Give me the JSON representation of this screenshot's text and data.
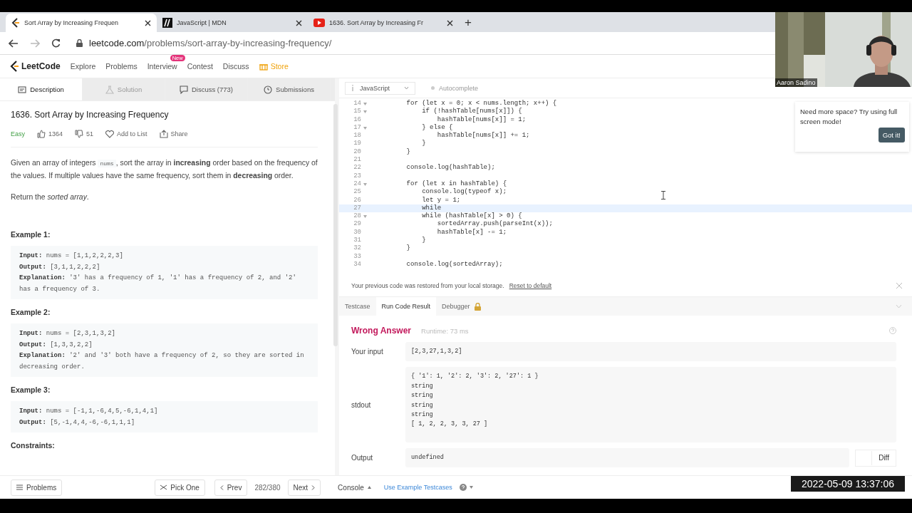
{
  "browser": {
    "tabs": [
      {
        "title": "Sort Array by Increasing Frequen",
        "selected": true
      },
      {
        "title": "JavaScript | MDN",
        "selected": false
      },
      {
        "title": "1636. Sort Array by Increasing Fr",
        "selected": false
      }
    ],
    "new_tab": "+",
    "url_host": "leetcode.com",
    "url_path": "/problems/sort-array-by-increasing-frequency/"
  },
  "nav": {
    "logo": "LeetCode",
    "items": [
      {
        "label": "Explore",
        "kind": "plain"
      },
      {
        "label": "Problems",
        "kind": "plain"
      },
      {
        "label": "Interview",
        "kind": "plain",
        "badge": "New"
      },
      {
        "label": "Contest",
        "kind": "plain"
      },
      {
        "label": "Discuss",
        "kind": "plain"
      },
      {
        "label": "Store",
        "kind": "store"
      }
    ]
  },
  "problem_tabs": [
    {
      "label": "Description",
      "selected": true,
      "disabled": false
    },
    {
      "label": "Solution",
      "selected": false,
      "disabled": true
    },
    {
      "label": "Discuss (773)",
      "selected": false,
      "disabled": false
    },
    {
      "label": "Submissions",
      "selected": false,
      "disabled": false
    }
  ],
  "problem": {
    "title": "1636. Sort Array by Increasing Frequency",
    "difficulty": "Easy",
    "likes": "1364",
    "dislikes": "51",
    "add_to_list": "Add to List",
    "share": "Share",
    "description": [
      [
        {
          "kind": "text",
          "text": "Given an array of integers "
        },
        {
          "kind": "code",
          "text": "nums"
        },
        {
          "kind": "text",
          "text": ", sort the array in **increasing** order based on the frequency of the values. If multiple values have the same frequency, sort them in **decreasing** order."
        }
      ],
      [
        {
          "kind": "text",
          "text": "Return the *sorted array*."
        }
      ]
    ],
    "examples": [
      {
        "heading": "Example 1:",
        "lines": [
          {
            "label": "Input:",
            "value": "nums = [1,1,2,2,2,3]"
          },
          {
            "label": "Output:",
            "value": "[3,1,1,2,2,2]"
          },
          {
            "label": "Explanation:",
            "value": "'3' has a frequency of 1, '1' has a frequency of 2, and '2' has a frequency of 3."
          }
        ]
      },
      {
        "heading": "Example 2:",
        "lines": [
          {
            "label": "Input:",
            "value": "nums = [2,3,1,3,2]"
          },
          {
            "label": "Output:",
            "value": "[1,3,3,2,2]"
          },
          {
            "label": "Explanation:",
            "value": "'2' and '3' both have a frequency of 2, so they are sorted in decreasing order."
          }
        ]
      },
      {
        "heading": "Example 3:",
        "lines": [
          {
            "label": "Input:",
            "value": "nums = [-1,1,-6,4,5,-6,1,4,1]"
          },
          {
            "label": "Output:",
            "value": "[5,-1,4,4,-6,-6,1,1,1]"
          }
        ]
      }
    ],
    "constraints_heading": "Constraints:"
  },
  "editor": {
    "language": "JavaScript",
    "autocomplete": "Autocomplete",
    "lines": [
      {
        "number": "14",
        "foldable": true,
        "active": false,
        "code": "    for (let x = 0; x < nums.length; x++) {"
      },
      {
        "number": "15",
        "foldable": true,
        "active": false,
        "code": "        if (!hashTable[nums[x]]) {"
      },
      {
        "number": "16",
        "foldable": false,
        "active": false,
        "code": "            hashTable[nums[x]] = 1;"
      },
      {
        "number": "17",
        "foldable": true,
        "active": false,
        "code": "        } else {"
      },
      {
        "number": "18",
        "foldable": false,
        "active": false,
        "code": "            hashTable[nums[x]] += 1;"
      },
      {
        "number": "19",
        "foldable": false,
        "active": false,
        "code": "        }"
      },
      {
        "number": "20",
        "foldable": false,
        "active": false,
        "code": "    }"
      },
      {
        "number": "21",
        "foldable": false,
        "active": false
      },
      {
        "number": "22",
        "foldable": false,
        "active": false,
        "code": "    console.log(hashTable);"
      },
      {
        "number": "23",
        "foldable": false,
        "active": false
      },
      {
        "number": "24",
        "foldable": true,
        "active": false,
        "code": "    for (let x in hashTable) {"
      },
      {
        "number": "25",
        "foldable": false,
        "active": false,
        "code": "        console.log(typeof x);"
      },
      {
        "number": "26",
        "foldable": false,
        "active": false,
        "code": "        let y = 1;"
      },
      {
        "number": "27",
        "foldable": false,
        "active": true,
        "code": "        while"
      },
      {
        "number": "28",
        "foldable": true,
        "active": false,
        "code": "        while (hashTable[x] > 0) {"
      },
      {
        "number": "29",
        "foldable": false,
        "active": false,
        "code": "            sortedArray.push(parseInt(x));"
      },
      {
        "number": "30",
        "foldable": false,
        "active": false,
        "code": "            hashTable[x] -= 1;"
      },
      {
        "number": "31",
        "foldable": false,
        "active": false,
        "code": "        }"
      },
      {
        "number": "32",
        "foldable": false,
        "active": false,
        "code": "    }"
      },
      {
        "number": "33",
        "foldable": false,
        "active": false
      },
      {
        "number": "34",
        "foldable": false,
        "active": false,
        "code": "    console.log(sortedArray);"
      }
    ]
  },
  "notice": {
    "text": "Your previous code was restored from your local storage.",
    "link": "Reset to default"
  },
  "result_tabs": [
    {
      "label": "Testcase",
      "selected": false,
      "locked": false
    },
    {
      "label": "Run Code Result",
      "selected": true,
      "locked": false
    },
    {
      "label": "Debugger",
      "selected": false,
      "locked": true
    }
  ],
  "result": {
    "status": "Wrong Answer",
    "runtime": "Runtime: 73 ms",
    "rows": [
      {
        "label": "Your input",
        "lines": [
          "[2,3,27,1,3,2]"
        ]
      },
      {
        "label": "stdout",
        "lines": [
          "{ '1': 1, '2': 2, '3': 2, '27': 1 }",
          "string",
          "string",
          "string",
          "string",
          "[ 1, 2, 2, 3, 3, 27 ]"
        ]
      },
      {
        "label": "Output",
        "lines": [
          "undefined"
        ],
        "diff": {
          "label": "Diff",
          "on": false
        }
      }
    ]
  },
  "popup": {
    "text": "Need more space? Try using full screen mode!",
    "button": "Got it!"
  },
  "bottom_bar": {
    "problems": "Problems",
    "pick_one": "Pick One",
    "prev": "Prev",
    "counter": "282/380",
    "next": "Next",
    "console": "Console",
    "example_testcases": "Use Example Testcases"
  },
  "webcam": {
    "kind": "picture",
    "name": "Aaron Sadino"
  },
  "timestamp": "2022-05-09 13:37:06"
}
